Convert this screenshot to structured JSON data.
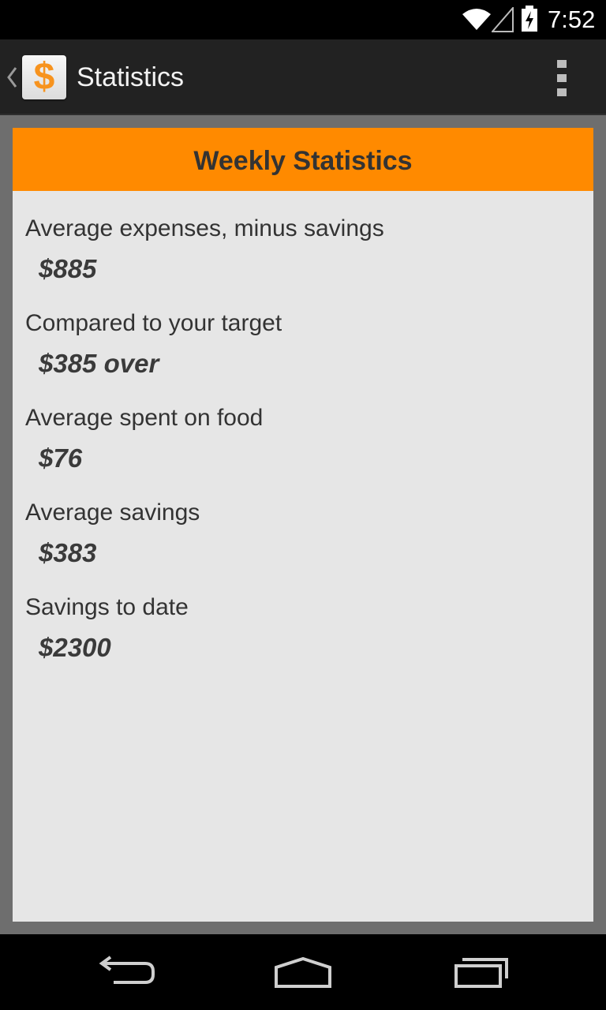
{
  "status_bar": {
    "time": "7:52",
    "icons": [
      "wifi-icon",
      "signal-icon",
      "battery-charging-icon"
    ]
  },
  "action_bar": {
    "title": "Statistics",
    "app_icon_glyph": "$",
    "up_icon": "chevron-left-icon",
    "overflow_icon": "overflow-menu-icon"
  },
  "card": {
    "header": "Weekly Statistics",
    "stats": [
      {
        "label": "Average expenses, minus savings",
        "value": "$885"
      },
      {
        "label": "Compared to your target",
        "value": "$385 over"
      },
      {
        "label": "Average spent on food",
        "value": "$76"
      },
      {
        "label": "Average savings",
        "value": "$383"
      },
      {
        "label": "Savings to date",
        "value": "$2300"
      }
    ]
  },
  "nav_bar": {
    "buttons": [
      "back-icon",
      "home-icon",
      "recent-apps-icon"
    ]
  },
  "colors": {
    "accent": "#ff8a00",
    "app_icon_dollar": "#f7931e",
    "action_bar": "#222222",
    "card_background": "#e6e6e6",
    "content_background": "#6e6e6e"
  }
}
